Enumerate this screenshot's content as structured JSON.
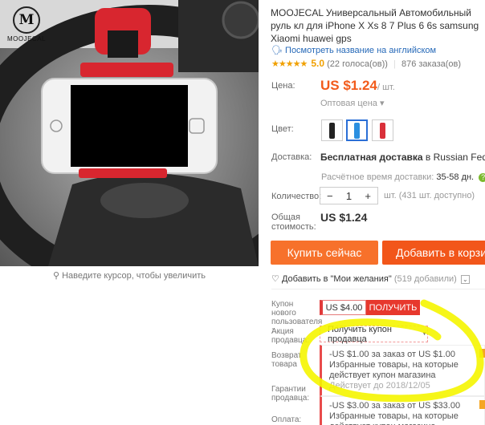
{
  "brand": {
    "logo_letter": "M",
    "logo_text": "MOOJECAL"
  },
  "photo": {
    "zoom_hint": "Наведите курсор, чтобы увеличить"
  },
  "product": {
    "title": "MOOJECAL Универсальный Автомобильный руль кл для iPhone X Xs 8 7 Plus 6 6s samsung Xiaomi huawei gps",
    "translate_link": "Посмотреть название на английском",
    "stars": "★★★★★",
    "rating": "5.0",
    "votes": "(22 голоса(ов))",
    "orders": "876 заказа(ов)"
  },
  "price": {
    "label": "Цена:",
    "value": "US $1.24",
    "unit": "/ шт.",
    "wholesale": "Оптовая цена ▾"
  },
  "color": {
    "label": "Цвет:",
    "options": [
      {
        "name": "black",
        "hex": "#222222"
      },
      {
        "name": "blue",
        "hex": "#2b8fe0"
      },
      {
        "name": "red",
        "hex": "#d9303a"
      }
    ],
    "selected_index": 1
  },
  "shipping": {
    "label": "Доставка:",
    "value_bold": "Бесплатная доставка",
    "value_rest": " в Russian Federation слу",
    "time_label": "Расчётное время доставки:",
    "time_value": "35-58 дн.",
    "help": "?"
  },
  "quantity": {
    "label": "Количество:",
    "minus": "−",
    "value": "1",
    "plus": "+",
    "available": "шт. (431 шт. доступно)"
  },
  "total": {
    "label": "Общая стоимость:",
    "value": "US $1.24"
  },
  "actions": {
    "buy": "Купить сейчас",
    "cart": "Добавить в корзину",
    "wishlist_icon": "heart-icon",
    "wishlist": "Добавить в \"Мои желания\"",
    "wishlist_count": "(519 добавили)",
    "wishlist_chevron": "⌄"
  },
  "coupons": {
    "new_user_label": "Купон нового пользователя :",
    "new_user_amount": "US $4.00",
    "new_user_button": "ПОЛУЧИТЬ",
    "seller_label": "Акция продавца:",
    "seller_dropdown": "Получить купон продавца",
    "return_label": "Возврат товара",
    "warranty_label": "Гарантии продавца:",
    "payment_label": "Оплата:",
    "offers": [
      {
        "title": "-US $1.00 за заказ от US $1.00",
        "desc": "Избранные товары, на которые действует купон магазина",
        "expires": "Действует до 2018/12/05"
      },
      {
        "title": "-US $3.00 за заказ от US $33.00",
        "desc": "Избранные товары, на которые действует купон магазина",
        "expires": ""
      }
    ]
  },
  "highlight_color": "#f5f500"
}
